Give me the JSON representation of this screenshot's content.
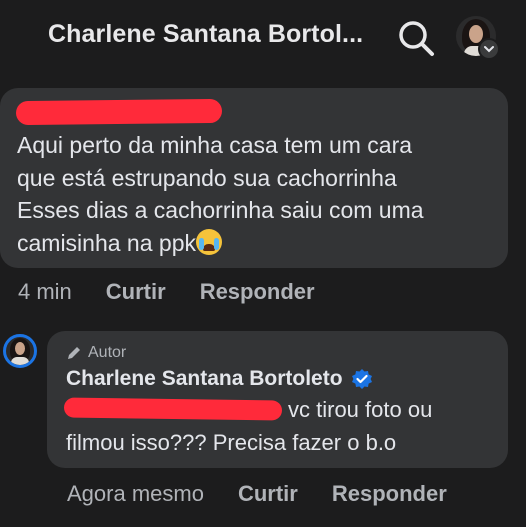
{
  "header": {
    "title": "Charlene Santana Bortol...",
    "search_icon": "search-icon",
    "avatar_icon": "profile-avatar"
  },
  "comment": {
    "text_line1": "Aqui perto da minha casa tem um cara",
    "text_line2": "que está estrupando sua cachorrinha",
    "text_line3": "Esses dias a cachorrinha saiu com uma",
    "text_line4": "camisinha na ppk",
    "emoji": "crying-face-emoji",
    "time": "4 min",
    "like_label": "Curtir",
    "reply_label": "Responder"
  },
  "reply": {
    "author_badge": "Autor",
    "author_name": "Charlene Santana Bortoleto",
    "text_line1": "vc tirou foto ou",
    "text_line2": "filmou isso??? Precisa fazer o b.o",
    "time": "Agora mesmo",
    "like_label": "Curtir",
    "reply_label": "Responder"
  },
  "colors": {
    "background": "#1c1c1d",
    "bubble": "#333436",
    "redaction": "#ff2a3a",
    "verified": "#1b74e4"
  }
}
